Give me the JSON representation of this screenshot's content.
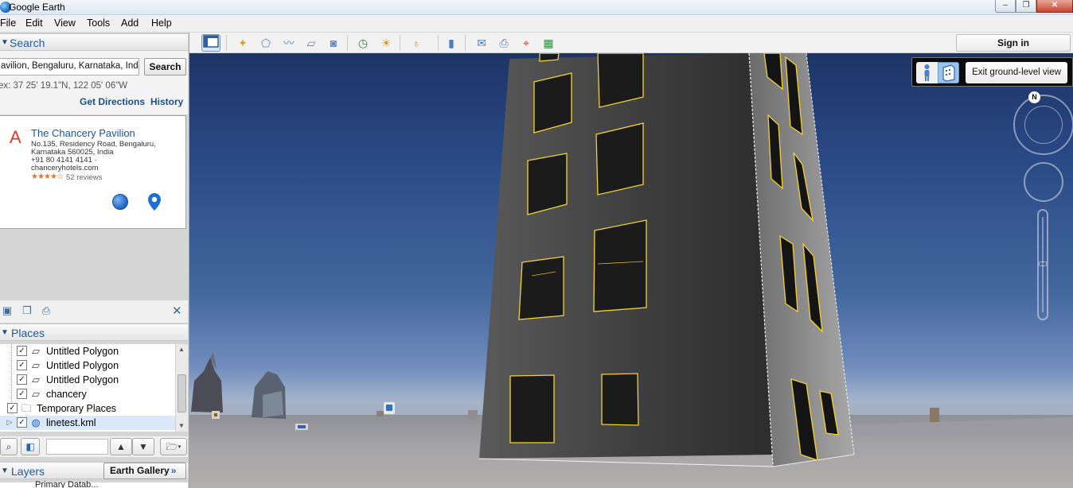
{
  "window": {
    "title": "Google Earth",
    "min_glyph": "–",
    "max_glyph": "❐",
    "close_glyph": "✕"
  },
  "menu": [
    "File",
    "Edit",
    "View",
    "Tools",
    "Add",
    "Help"
  ],
  "toolbar": {
    "sign_in_label": "Sign in"
  },
  "search": {
    "header": "Search",
    "input_value": "avilion, Bengaluru, Karnataka, India",
    "button_label": "Search",
    "coordinates": "ex: 37 25' 19.1\"N, 122 05' 06\"W",
    "get_directions": "Get Directions",
    "history": "History",
    "result": {
      "letter": "A",
      "name": "The Chancery Pavilion",
      "address_lines": [
        "No.135, Residency Road, Bengaluru,",
        "Karnataka 560025, India",
        "+91 80 4141 4141 ·",
        "chanceryhotels.com"
      ],
      "stars": "★★★★☆",
      "rating": 3.5,
      "reviews": "52 reviews"
    }
  },
  "places": {
    "header": "Places",
    "items": [
      {
        "label": "Untitled Polygon",
        "checked": "✓"
      },
      {
        "label": "Untitled Polygon",
        "checked": "✓"
      },
      {
        "label": "Untitled Polygon",
        "checked": "✓"
      },
      {
        "label": "chancery",
        "checked": "✓"
      },
      {
        "label": "Temporary Places",
        "checked": "✓"
      },
      {
        "label": "linetest.kml",
        "checked": "✓"
      }
    ],
    "close_glyph": "✕"
  },
  "layers": {
    "header": "Layers",
    "earth_gallery": "Earth Gallery",
    "next_item": "Primary Datab..."
  },
  "viewport": {
    "exit_ground_level": "Exit ground-level view",
    "compass_letter": "N"
  },
  "colors": {
    "link_blue": "#1a4f8c",
    "result_letter": "#dd3b2a",
    "window_outline": "#f3d230"
  }
}
